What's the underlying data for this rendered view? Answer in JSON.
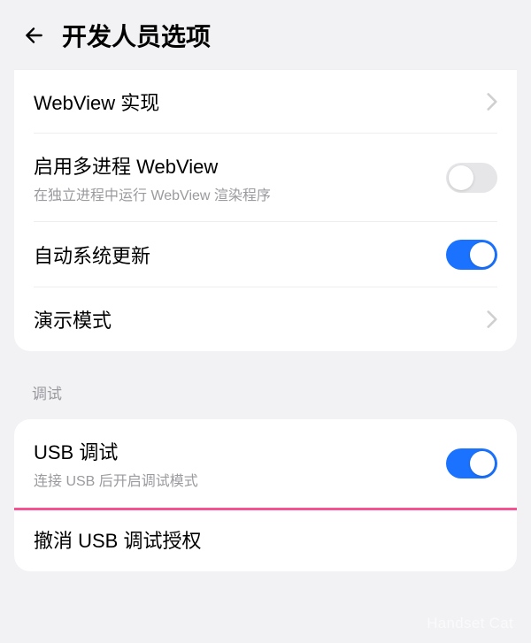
{
  "header": {
    "title": "开发人员选项"
  },
  "group1": {
    "webview": {
      "title": "WebView 实现"
    },
    "multiprocess": {
      "title": "启用多进程 WebView",
      "subtitle": "在独立进程中运行 WebView 渲染程序",
      "enabled": false
    },
    "autoupdate": {
      "title": "自动系统更新",
      "enabled": true
    },
    "demomode": {
      "title": "演示模式"
    }
  },
  "section_debug": {
    "label": "调试"
  },
  "group2": {
    "usbdebug": {
      "title": "USB 调试",
      "subtitle": "连接 USB 后开启调试模式",
      "enabled": true
    },
    "revokeusb": {
      "title": "撤消 USB 调试授权"
    }
  },
  "watermark": "Handset Cat"
}
